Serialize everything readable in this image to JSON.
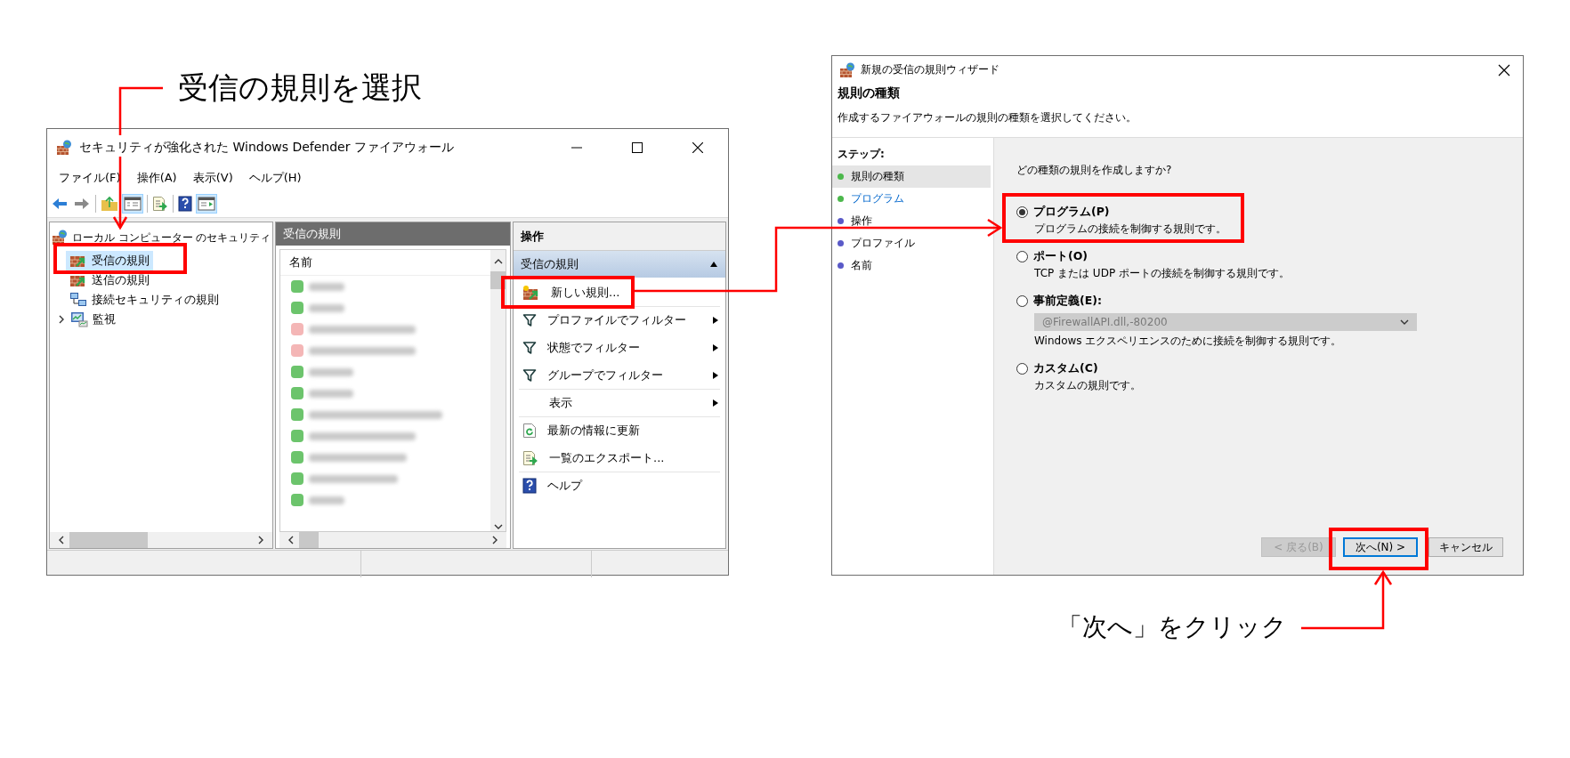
{
  "callouts": {
    "select_rule": "受信の規則を選択",
    "click_next": "「次へ」をクリック"
  },
  "firewall_window": {
    "title": "セキュリティが強化された Windows Defender ファイアウォール",
    "menu": [
      "ファイル(F)",
      "操作(A)",
      "表示(V)",
      "ヘルプ(H)"
    ],
    "tree": {
      "label": "ローカル コンピューター のセキュリティ",
      "children": [
        {
          "label": "受信の規則",
          "kind": "leaf",
          "selected": true
        },
        {
          "label": "送信の規則",
          "kind": "leaf",
          "selected": false
        },
        {
          "label": "接続セキュリティの規則",
          "kind": "leaf",
          "selected": false
        },
        {
          "label": "監視",
          "kind": "group",
          "expanded": false,
          "selected": false
        }
      ]
    },
    "list": {
      "header": "受信の規則",
      "column": "名前",
      "rows": [
        {
          "color": "#6cc46c"
        },
        {
          "color": "#6cc46c"
        },
        {
          "color": "#f4b6b6"
        },
        {
          "color": "#f4b6b6"
        },
        {
          "color": "#6cc46c"
        },
        {
          "color": "#6cc46c"
        },
        {
          "color": "#6cc46c"
        },
        {
          "color": "#6cc46c"
        },
        {
          "color": "#6cc46c"
        },
        {
          "color": "#6cc46c"
        },
        {
          "color": "#6cc46c"
        }
      ]
    },
    "actions": {
      "header": "操作",
      "section": {
        "label": "受信の規則",
        "expanded": true
      },
      "items": [
        {
          "label": "新しい規則...",
          "kind": "create",
          "submenu": false
        },
        {
          "label": "プロファイルでフィルター",
          "kind": "filter",
          "submenu": true
        },
        {
          "label": "状態でフィルター",
          "kind": "filter",
          "submenu": true
        },
        {
          "label": "グループでフィルター",
          "kind": "filter",
          "submenu": true
        },
        {
          "label": "表示",
          "kind": "view",
          "submenu": true
        },
        {
          "label": "最新の情報に更新",
          "kind": "refresh",
          "submenu": false
        },
        {
          "label": "一覧のエクスポート...",
          "kind": "export",
          "submenu": false
        },
        {
          "label": "ヘルプ",
          "kind": "help",
          "submenu": false
        }
      ]
    }
  },
  "wizard": {
    "title": "新規の受信の規則ウィザード",
    "heading": "規則の種類",
    "subtitle": "作成するファイアウォールの規則の種類を選択してください。",
    "steps_label": "ステップ:",
    "steps": [
      {
        "label": "規則の種類",
        "selected": true,
        "link": false,
        "color": "#4cb84c"
      },
      {
        "label": "プログラム",
        "selected": false,
        "link": true,
        "color": "#4cb84c"
      },
      {
        "label": "操作",
        "selected": false,
        "link": false,
        "color": "#5a5ac8"
      },
      {
        "label": "プロファイル",
        "selected": false,
        "link": false,
        "color": "#5a5ac8"
      },
      {
        "label": "名前",
        "selected": false,
        "link": false,
        "color": "#5a5ac8"
      }
    ],
    "question": "どの種類の規則を作成しますか?",
    "options": [
      {
        "label": "プログラム(P)",
        "description": "プログラムの接続を制御する規則です。",
        "selected": true
      },
      {
        "label": "ポート(O)",
        "description": "TCP または UDP ポートの接続を制御する規則です。",
        "selected": false
      },
      {
        "label": "事前定義(E):",
        "dropdown": {
          "value": "@FirewallAPI.dll,-80200",
          "disabled": true
        },
        "description": "Windows エクスペリエンスのために接続を制御する規則です。",
        "selected": false
      },
      {
        "label": "カスタム(C)",
        "description": "カスタムの規則です。",
        "selected": false
      }
    ],
    "buttons": [
      {
        "label": "< 戻る(B)",
        "disabled": true,
        "default": false
      },
      {
        "label": "次へ(N) >",
        "disabled": false,
        "default": true
      },
      {
        "label": "キャンセル",
        "disabled": false,
        "default": false
      }
    ]
  }
}
